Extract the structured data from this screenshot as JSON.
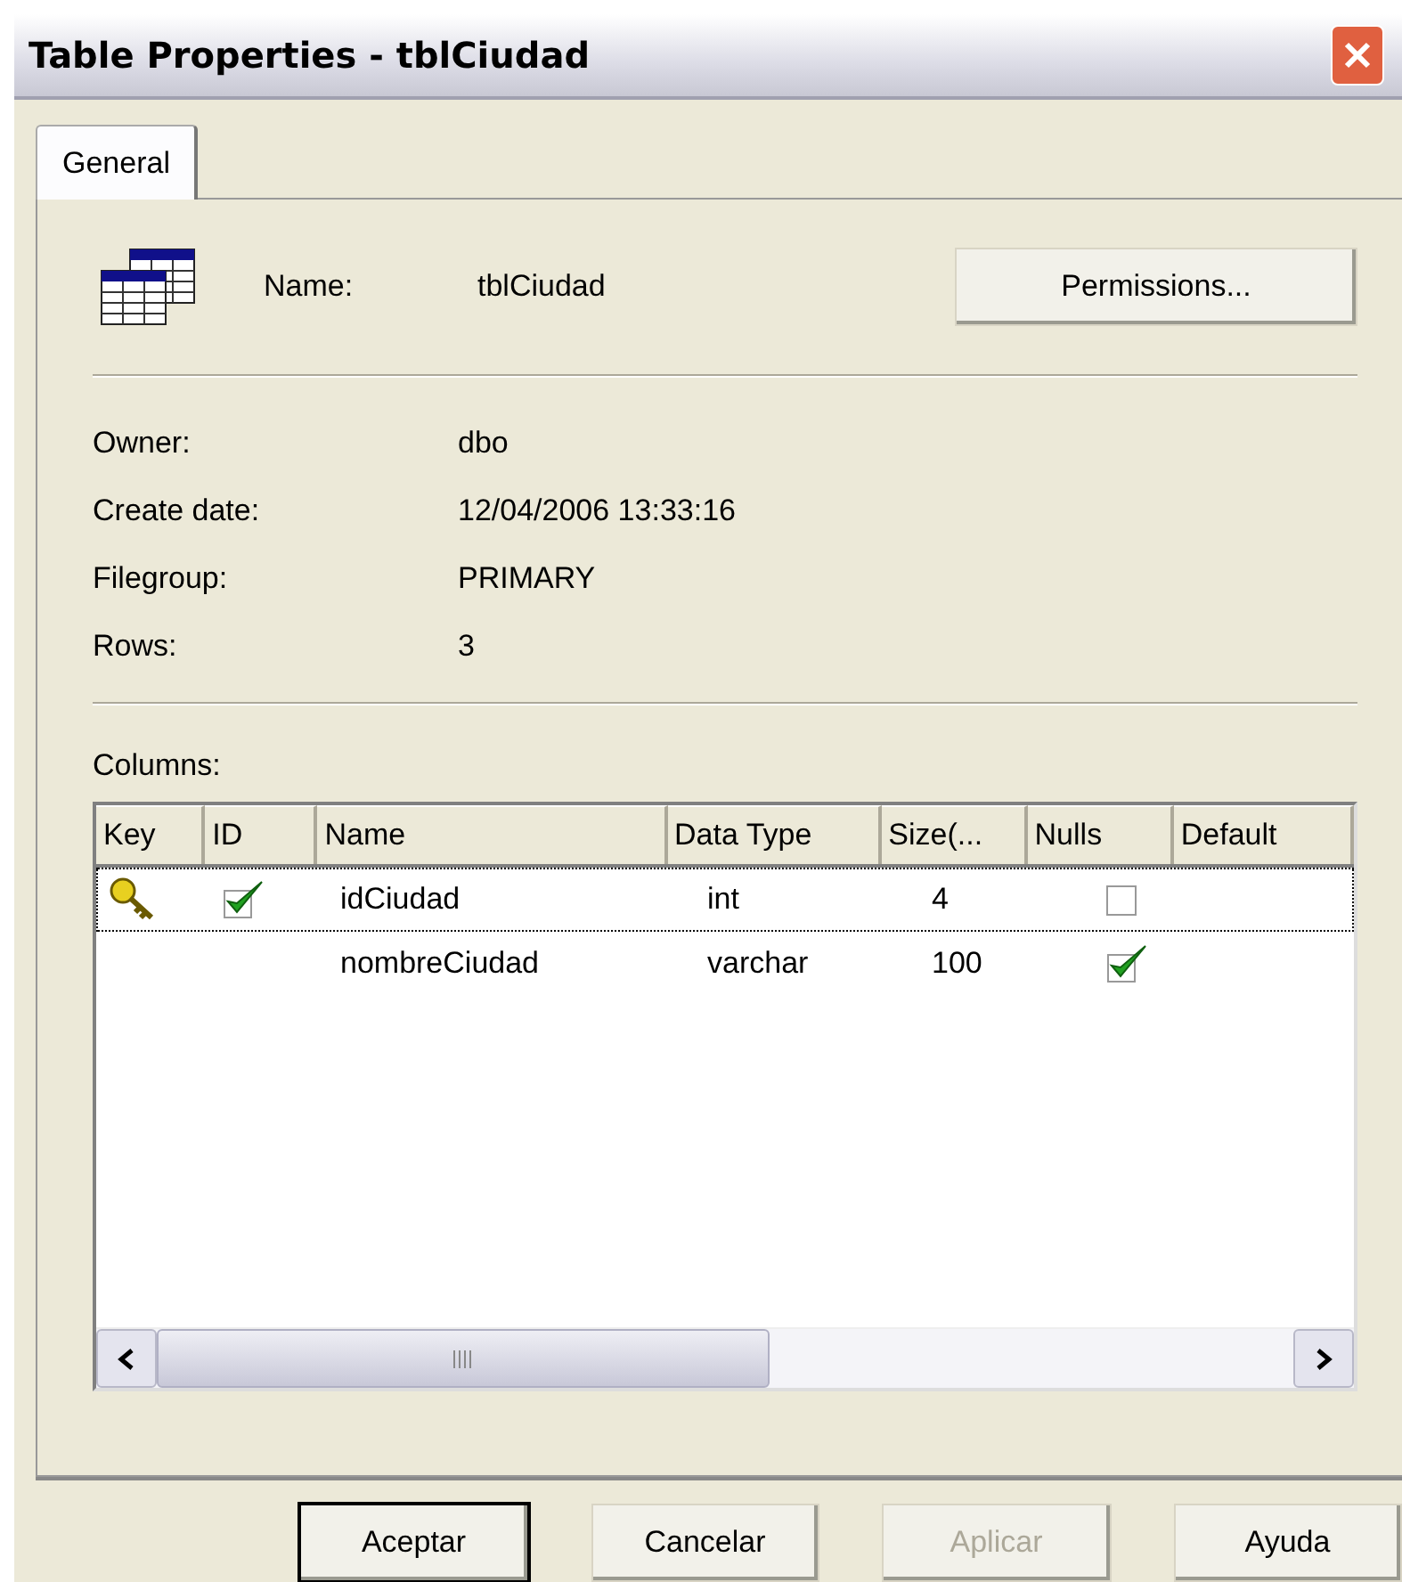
{
  "window": {
    "title": "Table Properties - tblCiudad"
  },
  "tabs": [
    {
      "label": "General",
      "selected": true
    }
  ],
  "name_row": {
    "label": "Name:",
    "value": "tblCiudad",
    "button": "Permissions..."
  },
  "properties": [
    {
      "label": "Owner:",
      "value": "dbo"
    },
    {
      "label": "Create date:",
      "value": "12/04/2006 13:33:16"
    },
    {
      "label": "Filegroup:",
      "value": "PRIMARY"
    },
    {
      "label": "Rows:",
      "value": "3"
    }
  ],
  "columns_label": "Columns:",
  "table": {
    "columns": [
      "Key",
      "ID",
      "Name",
      "Data Type",
      "Size(...",
      "Nulls",
      "Default"
    ],
    "rows": [
      {
        "key": true,
        "id": true,
        "name": "idCiudad",
        "data_type": "int",
        "size": "4",
        "nulls": false,
        "selected": true
      },
      {
        "key": false,
        "id": false,
        "name": "nombreCiudad",
        "data_type": "varchar",
        "size": "100",
        "nulls": true,
        "selected": false
      }
    ]
  },
  "buttons": [
    {
      "label": "Aceptar",
      "default": true,
      "disabled": false
    },
    {
      "label": "Cancelar",
      "default": false,
      "disabled": false
    },
    {
      "label": "Aplicar",
      "default": false,
      "disabled": true
    },
    {
      "label": "Ayuda",
      "default": false,
      "disabled": false
    }
  ]
}
